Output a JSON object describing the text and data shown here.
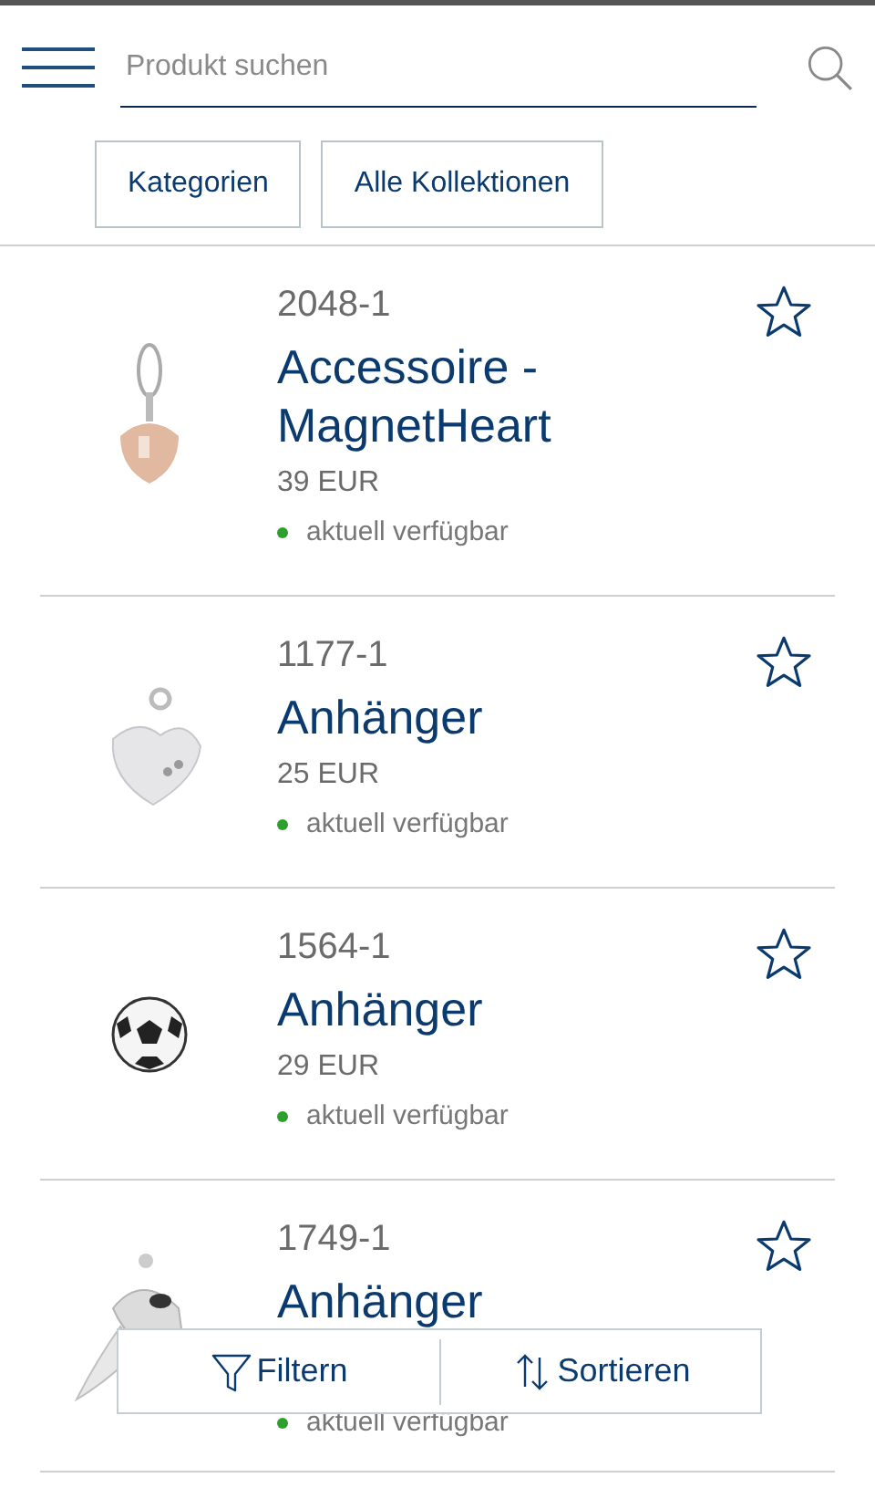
{
  "search": {
    "placeholder": "Produkt suchen"
  },
  "filters": [
    "Kategorien",
    "Alle Kollektionen"
  ],
  "products": [
    {
      "sku": "2048-1",
      "name": "Accessoire - MagnetHeart",
      "price": "39 EUR",
      "availability": "aktuell verfügbar",
      "available": true,
      "favorite": false
    },
    {
      "sku": "1177-1",
      "name": "Anhänger",
      "price": "25 EUR",
      "availability": "aktuell verfügbar",
      "available": true,
      "favorite": false
    },
    {
      "sku": "1564-1",
      "name": "Anhänger",
      "price": "29 EUR",
      "availability": "aktuell verfügbar",
      "available": true,
      "favorite": false
    },
    {
      "sku": "1749-1",
      "name": "Anhänger",
      "availability": "aktuell verfügbar",
      "available": true,
      "favorite": false
    }
  ],
  "actions": [
    "Filtern",
    "Sortieren"
  ]
}
